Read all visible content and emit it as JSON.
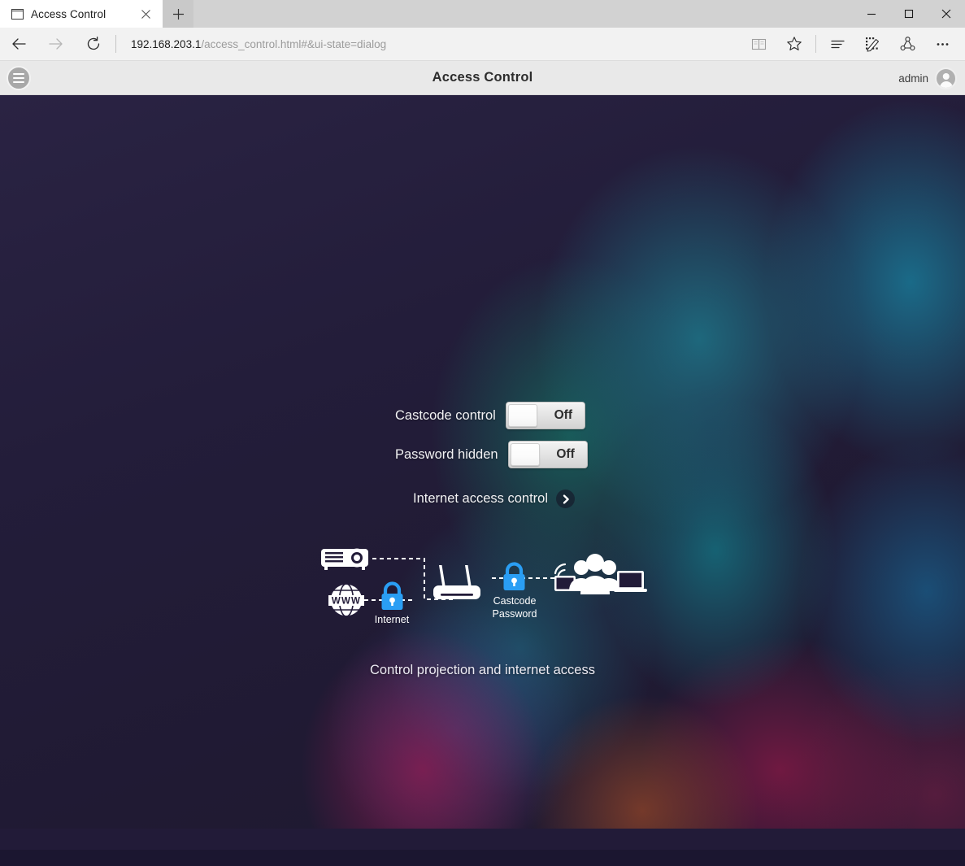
{
  "browser": {
    "tab": {
      "title": "Access Control",
      "favicon_icon": "page-icon",
      "close_icon": "close-icon"
    },
    "new_tab_label": "+",
    "nav": {
      "back_icon": "arrow-left-icon",
      "forward_icon": "arrow-right-icon",
      "refresh_icon": "refresh-icon"
    },
    "url": {
      "host": "192.168.203.1",
      "path": "/access_control.html#&ui-state=dialog"
    },
    "toolbar_icons": [
      "reading-view-icon",
      "favorites-star-icon",
      "hub-icon",
      "web-note-icon",
      "share-icon",
      "more-icon"
    ],
    "window_controls": {
      "minimize": "minimize-icon",
      "maximize": "maximize-icon",
      "close": "close-icon"
    }
  },
  "app": {
    "header": {
      "menu_icon": "hamburger-menu-icon",
      "title": "Access Control",
      "username": "admin",
      "avatar_icon": "user-avatar-icon"
    },
    "settings": [
      {
        "label": "Castcode control",
        "value": "Off",
        "state": "off"
      },
      {
        "label": "Password hidden",
        "value": "Off",
        "state": "off"
      }
    ],
    "link_row": {
      "label": "Internet access control",
      "chevron_icon": "chevron-right-icon"
    },
    "diagram": {
      "internet_label": "Internet",
      "castcode_label_line1": "Castcode",
      "castcode_label_line2": "Password",
      "icons": [
        "projector-icon",
        "www-globe-icon",
        "lock-icon",
        "router-icon",
        "wifi-icon",
        "tablet-icon",
        "people-icon",
        "laptop-icon"
      ]
    },
    "caption": "Control projection and internet access"
  },
  "colors": {
    "lock_blue": "#2a9ef4",
    "wallpaper_base": "#221b38",
    "header_bg": "#e9e9e9",
    "text_light": "#f2f2f4"
  }
}
